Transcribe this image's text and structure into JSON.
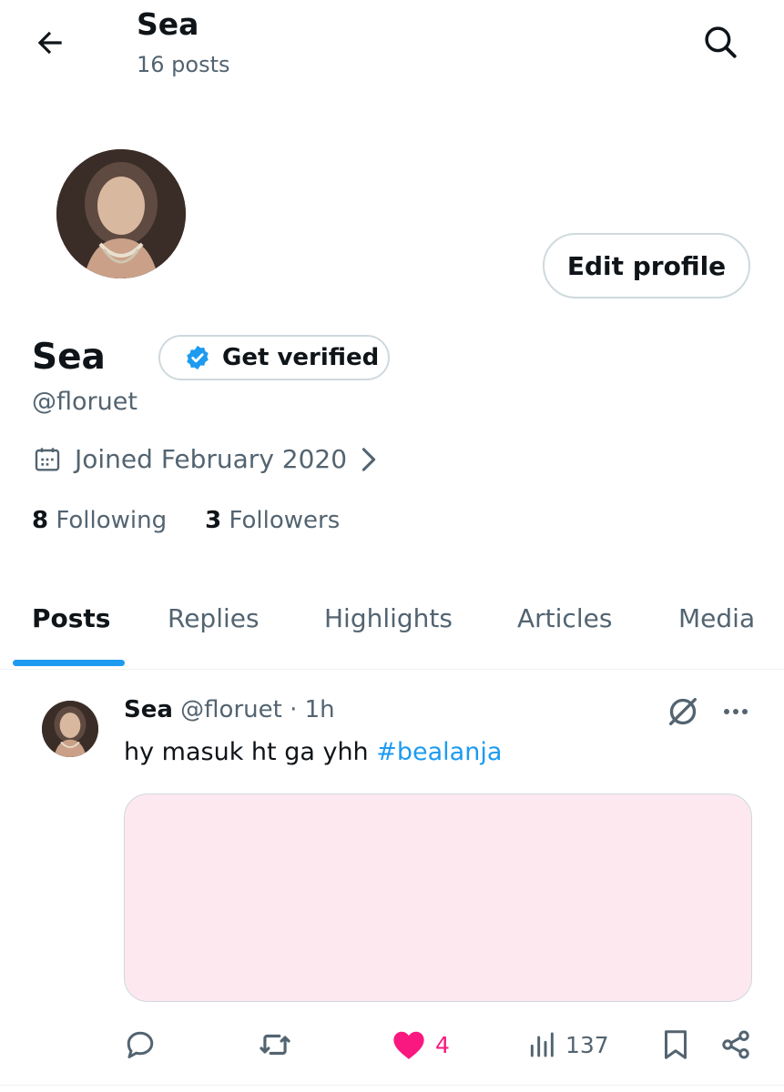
{
  "header": {
    "title": "Sea",
    "post_count": "16 posts",
    "back_icon": "arrow-left-icon",
    "search_icon": "search-icon"
  },
  "profile": {
    "name": "Sea",
    "handle": "@floruet",
    "edit_label": "Edit profile",
    "verify_label": "Get verified",
    "joined": "Joined February 2020",
    "following_count": "8",
    "following_label": "Following",
    "followers_count": "3",
    "followers_label": "Followers"
  },
  "tabs": [
    {
      "label": "Posts",
      "active": true
    },
    {
      "label": "Replies"
    },
    {
      "label": "Highlights"
    },
    {
      "label": "Articles"
    },
    {
      "label": "Media"
    }
  ],
  "post": {
    "name": "Sea",
    "handle": "@floruet",
    "dot": "·",
    "time": "1h",
    "text": "hy masuk ht ga yhh",
    "hashtag": "#bealanja",
    "media_color": "#fde8f0",
    "likes": "4",
    "views": "137"
  },
  "colors": {
    "accent": "#1d9bf0",
    "like": "#f91880",
    "muted": "#536471"
  }
}
